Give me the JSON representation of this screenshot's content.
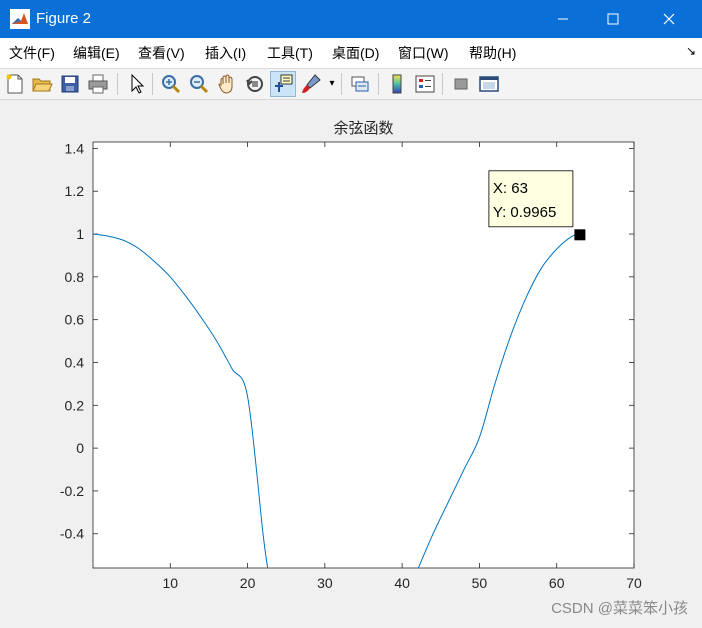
{
  "window": {
    "title": "Figure 2"
  },
  "menu": {
    "items": [
      "文件(F)",
      "编辑(E)",
      "查看(V)",
      "插入(I)",
      "工具(T)",
      "桌面(D)",
      "窗口(W)",
      "帮助(H)"
    ]
  },
  "toolbar": {
    "icons": [
      "new-figure-icon",
      "open-file-icon",
      "save-icon",
      "print-icon",
      "pointer-icon",
      "zoom-in-icon",
      "zoom-out-icon",
      "pan-hand-icon",
      "rotate-3d-icon",
      "data-cursor-icon",
      "brush-icon",
      "brush-dropdown-icon",
      "link-plot-icon",
      "colorbar-icon",
      "legend-icon",
      "hide-plot-tools-icon",
      "show-plot-tools-icon"
    ]
  },
  "chart_data": {
    "type": "line",
    "title": "余弦函数",
    "xlabel": "",
    "ylabel": "",
    "xlim": [
      0,
      70
    ],
    "ylim": [
      -0.56,
      1.43
    ],
    "x_ticks": [
      10,
      20,
      30,
      40,
      50,
      60,
      70
    ],
    "x_tick_labels": [
      "10",
      "20",
      "30",
      "40",
      "50",
      "60",
      "70"
    ],
    "y_ticks": [
      -0.4,
      -0.2,
      0,
      0.2,
      0.4,
      0.6,
      0.8,
      1,
      1.2,
      1.4
    ],
    "y_tick_labels": [
      "-0.4",
      "-0.2",
      "0",
      "0.2",
      "0.4",
      "0.6",
      "0.8",
      "1",
      "1.2",
      "1.4"
    ],
    "grid": false,
    "line_color": "#0072bd",
    "series": [
      {
        "x": [
          0,
          2,
          4,
          6,
          8,
          10,
          12,
          14,
          16,
          18,
          20,
          22,
          22.6,
          42.1,
          44,
          46,
          48,
          50,
          52,
          54,
          56,
          58,
          60,
          62,
          63
        ],
        "y": [
          1.0,
          0.99,
          0.97,
          0.93,
          0.87,
          0.8,
          0.71,
          0.61,
          0.5,
          0.37,
          0.24,
          -0.4,
          -0.56,
          -0.56,
          -0.4,
          -0.25,
          -0.1,
          0.05,
          0.3,
          0.52,
          0.7,
          0.84,
          0.93,
          0.99,
          0.9965
        ]
      }
    ],
    "datatip": {
      "x_label": "X: 63",
      "y_label": "Y: 0.9965",
      "x": 63,
      "y": 0.9965
    }
  },
  "watermark": "CSDN @菜菜笨小孩"
}
